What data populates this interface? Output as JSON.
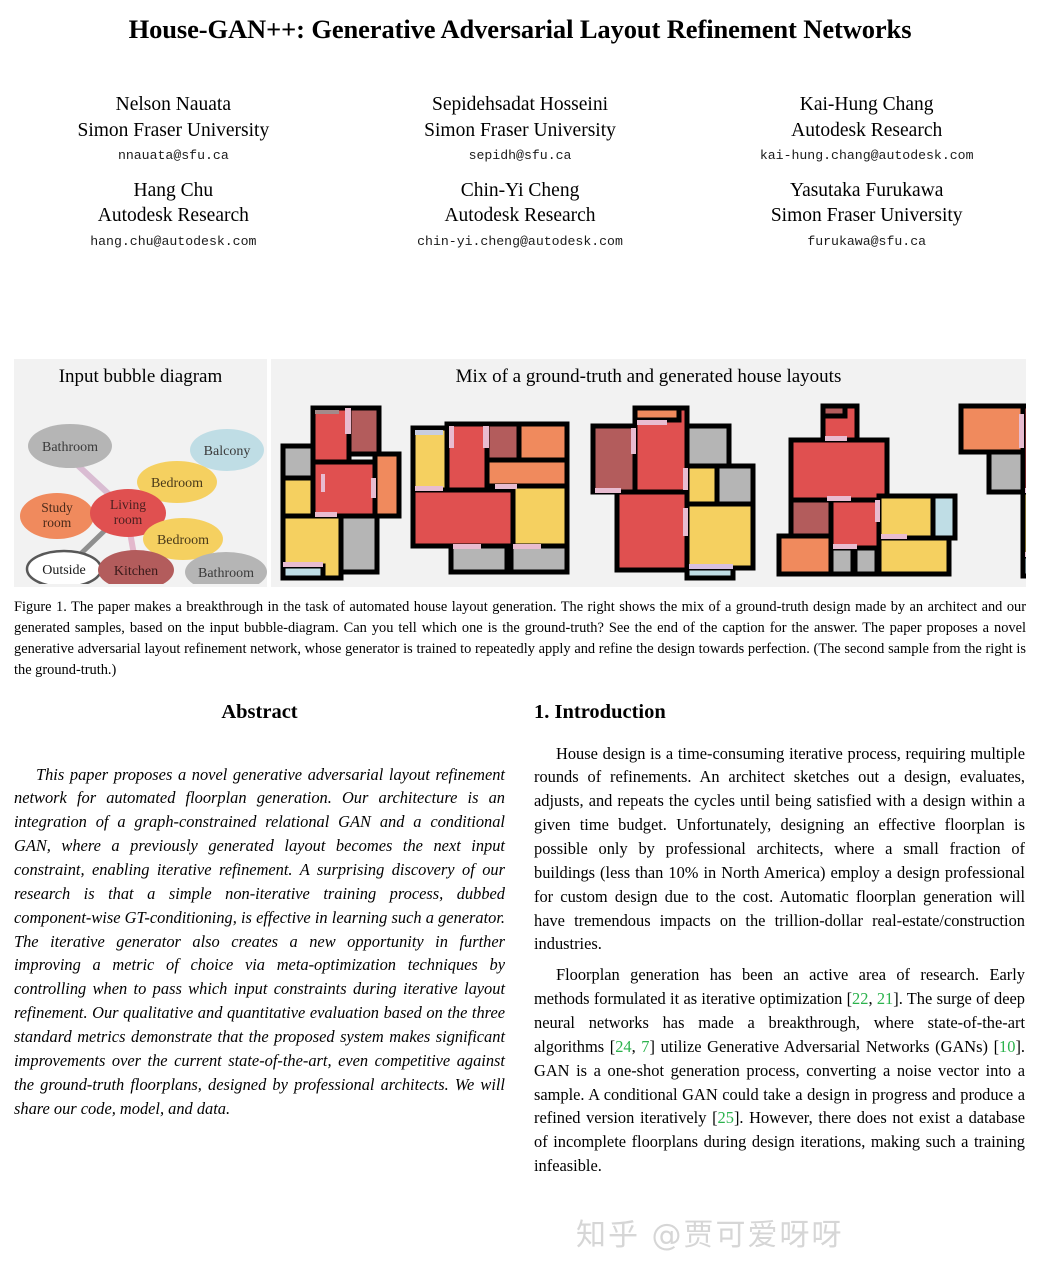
{
  "paper": {
    "title": "House-GAN++: Generative Adversarial Layout Refinement Networks"
  },
  "authors": [
    [
      {
        "name": "Nelson Nauata",
        "affiliation": "Simon Fraser University",
        "email": "nnauata@sfu.ca"
      },
      {
        "name": "Sepidehsadat Hosseini",
        "affiliation": "Simon Fraser University",
        "email": "sepidh@sfu.ca"
      },
      {
        "name": "Kai-Hung Chang",
        "affiliation": "Autodesk Research",
        "email": "kai-hung.chang@autodesk.com"
      }
    ],
    [
      {
        "name": "Hang Chu",
        "affiliation": "Autodesk Research",
        "email": "hang.chu@autodesk.com"
      },
      {
        "name": "Chin-Yi Cheng",
        "affiliation": "Autodesk Research",
        "email": "chin-yi.cheng@autodesk.com"
      },
      {
        "name": "Yasutaka Furukawa",
        "affiliation": "Simon Fraser University",
        "email": "furukawa@sfu.ca"
      }
    ]
  ],
  "figure": {
    "left_panel_title": "Input bubble diagram",
    "right_panel_title": "Mix of a ground-truth and generated house layouts",
    "bubbles": [
      {
        "label": "Bathroom",
        "color": "#b5b5b5"
      },
      {
        "label": "Balcony",
        "color": "#bfdde5"
      },
      {
        "label": "Bedroom",
        "color": "#f5d060"
      },
      {
        "label": "Study room",
        "color": "#f08a5d"
      },
      {
        "label": "Living room",
        "color": "#e05050"
      },
      {
        "label": "Bedroom",
        "color": "#f5d060"
      },
      {
        "label": "Outside",
        "color": "#ffffff"
      },
      {
        "label": "Kitchen",
        "color": "#b35c5c"
      },
      {
        "label": "Bathroom",
        "color": "#b5b5b5"
      }
    ],
    "room_colors": {
      "living_room": "#e05050",
      "bedroom": "#f5d060",
      "bathroom": "#b5b5b5",
      "kitchen": "#b35c5c",
      "study_room": "#f08a5d",
      "balcony": "#bfdde5",
      "wall": "#000000",
      "door": "#e8bcd0",
      "panel_background": "#f2f2f2"
    },
    "caption": "Figure 1. The paper makes a breakthrough in the task of automated house layout generation. The right shows the mix of a ground-truth design made by an architect and our generated samples, based on the input bubble-diagram. Can you tell which one is the ground-truth? See the end of the caption for the answer. The paper proposes a novel generative adversarial layout refinement network, whose generator is trained to repeatedly apply and refine the design towards perfection. (The second sample from the right is the ground-truth.)"
  },
  "abstract": {
    "heading": "Abstract",
    "text": "This paper proposes a novel generative adversarial layout refinement network for automated floorplan generation. Our architecture is an integration of a graph-constrained relational GAN and a conditional GAN, where a previously generated layout becomes the next input constraint, enabling iterative refinement. A surprising discovery of our research is that a simple non-iterative training process, dubbed component-wise GT-conditioning, is effective in learning such a generator. The iterative generator also creates a new opportunity in further improving a metric of choice via meta-optimization techniques by controlling when to pass which input constraints during iterative layout refinement. Our qualitative and quantitative evaluation based on the three standard metrics demonstrate that the proposed system makes significant improvements over the current state-of-the-art, even competitive against the ground-truth floorplans, designed by professional architects. We will share our code, model, and data."
  },
  "introduction": {
    "heading": "1. Introduction",
    "paragraph1": "House design is a time-consuming iterative process, requiring multiple rounds of refinements. An architect sketches out a design, evaluates, adjusts, and repeats the cycles until being satisfied with a design within a given time budget. Unfortunately, designing an effective floorplan is possible only by professional architects, where a small fraction of buildings (less than 10% in North America) employ a design professional for custom design due to the cost. Automatic floorplan generation will have tremendous impacts on the trillion-dollar real-estate/construction industries.",
    "paragraph2": {
      "part1": "Floorplan generation has been an active area of research. Early methods formulated it as iterative optimization [",
      "cite1": "22",
      "sep1": ", ",
      "cite2": "21",
      "part2": "]. The surge of deep neural networks has made a breakthrough, where state-of-the-art algorithms [",
      "cite3": "24",
      "sep2": ", ",
      "cite4": "7",
      "part3": "] utilize Generative Adversarial Networks (GANs) [",
      "cite5": "10",
      "part4": "]. GAN is a one-shot generation process, converting a noise vector into a sample. A conditional GAN could take a design in progress and produce a refined version iteratively [",
      "cite6": "25",
      "part5": "]. However, there does not exist a database of incomplete floorplans during design iterations, making such a training infeasible."
    }
  },
  "watermark": {
    "text": "知乎 @贾可爱呀呀"
  }
}
